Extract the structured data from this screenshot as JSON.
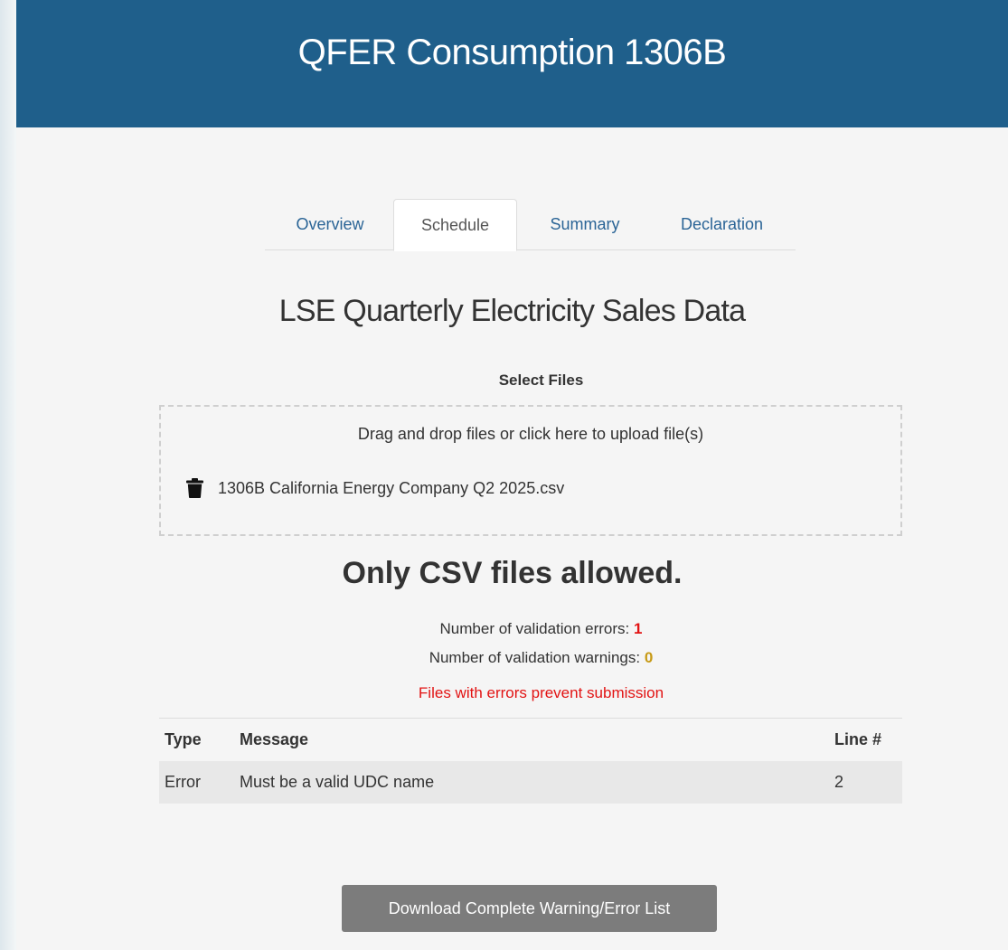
{
  "header": {
    "title": "QFER Consumption 1306B"
  },
  "tabs": [
    {
      "label": "Overview",
      "active": false
    },
    {
      "label": "Schedule",
      "active": true
    },
    {
      "label": "Summary",
      "active": false
    },
    {
      "label": "Declaration",
      "active": false
    }
  ],
  "section": {
    "title": "LSE Quarterly Electricity Sales Data"
  },
  "upload": {
    "label": "Select Files",
    "hint": "Drag and drop files or click here to upload file(s)",
    "files": [
      {
        "name": "1306B California Energy Company Q2 2025.csv",
        "icon": "trash-icon"
      }
    ]
  },
  "validation": {
    "headline": "Only CSV files allowed.",
    "errors_label": "Number of validation errors:",
    "errors_count": "1",
    "warnings_label": "Number of validation warnings:",
    "warnings_count": "0",
    "submission_warning": "Files with errors prevent submission"
  },
  "table": {
    "headers": {
      "type": "Type",
      "message": "Message",
      "line": "Line #"
    },
    "rows": [
      {
        "type": "Error",
        "message": "Must be a valid UDC name",
        "line": "2"
      }
    ]
  },
  "actions": {
    "download_label": "Download Complete Warning/Error List"
  },
  "colors": {
    "header_bg": "#1f5f8b",
    "link": "#2a6496",
    "error": "#e21313",
    "warning": "#c79a16",
    "button_bg": "#7c7c7c"
  }
}
